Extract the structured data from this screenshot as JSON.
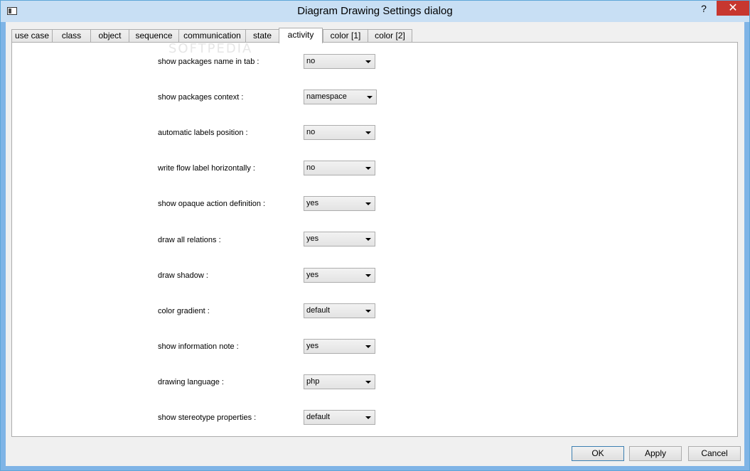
{
  "window": {
    "title": "Diagram Drawing Settings dialog",
    "help": "?",
    "close": "✕"
  },
  "tabs": [
    {
      "label": "use case"
    },
    {
      "label": "class"
    },
    {
      "label": "object"
    },
    {
      "label": "sequence"
    },
    {
      "label": "communication"
    },
    {
      "label": "state"
    },
    {
      "label": "activity",
      "active": true
    },
    {
      "label": "color [1]"
    },
    {
      "label": "color [2]"
    }
  ],
  "watermark": "SOFTPEDIA",
  "settings": [
    {
      "label": "show packages name in tab :",
      "value": "no"
    },
    {
      "label": "show packages context :",
      "value": "namespace"
    },
    {
      "label": "automatic labels position :",
      "value": "no"
    },
    {
      "label": "write flow label horizontally :",
      "value": "no"
    },
    {
      "label": "show opaque action definition :",
      "value": "yes"
    },
    {
      "label": "draw all relations :",
      "value": "yes"
    },
    {
      "label": "draw shadow :",
      "value": "yes"
    },
    {
      "label": "color gradient :",
      "value": "default"
    },
    {
      "label": "show information note :",
      "value": "yes"
    },
    {
      "label": "drawing language :",
      "value": "php"
    },
    {
      "label": "show stereotype properties :",
      "value": "default"
    }
  ],
  "buttons": {
    "ok": "OK",
    "apply": "Apply",
    "cancel": "Cancel"
  },
  "colors": {
    "titlebar": "#c8dff4",
    "close": "#c7372f",
    "border": "#5ea6d8"
  }
}
